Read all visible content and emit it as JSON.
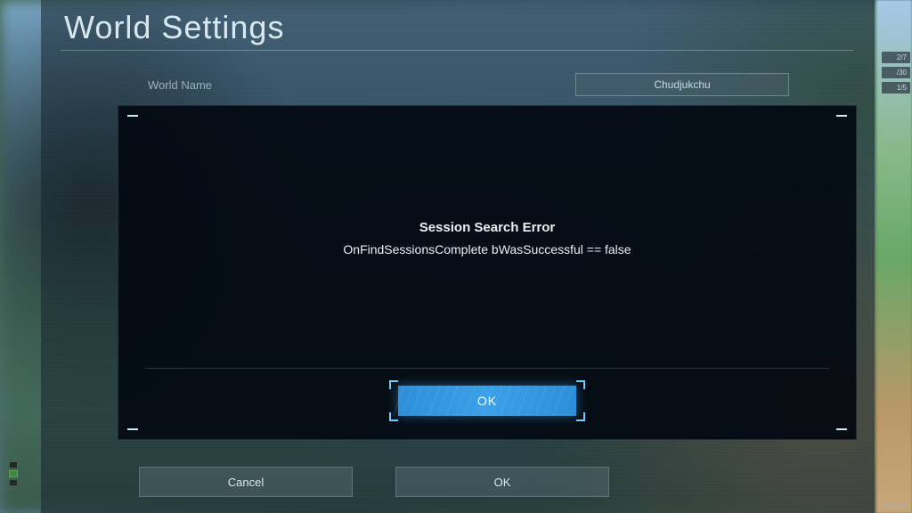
{
  "page": {
    "title": "World Settings"
  },
  "world_name": {
    "label": "World Name",
    "value": "Chudjukchu"
  },
  "modal": {
    "title": "Session Search Error",
    "message": "OnFindSessionsComplete bWasSuccessful == false",
    "ok_label": "OK"
  },
  "footer": {
    "cancel_label": "Cancel",
    "ok_label": "OK"
  },
  "hud": {
    "version": "v0.1.0.1",
    "badges": [
      "2/7",
      "/30",
      "1/5"
    ]
  }
}
